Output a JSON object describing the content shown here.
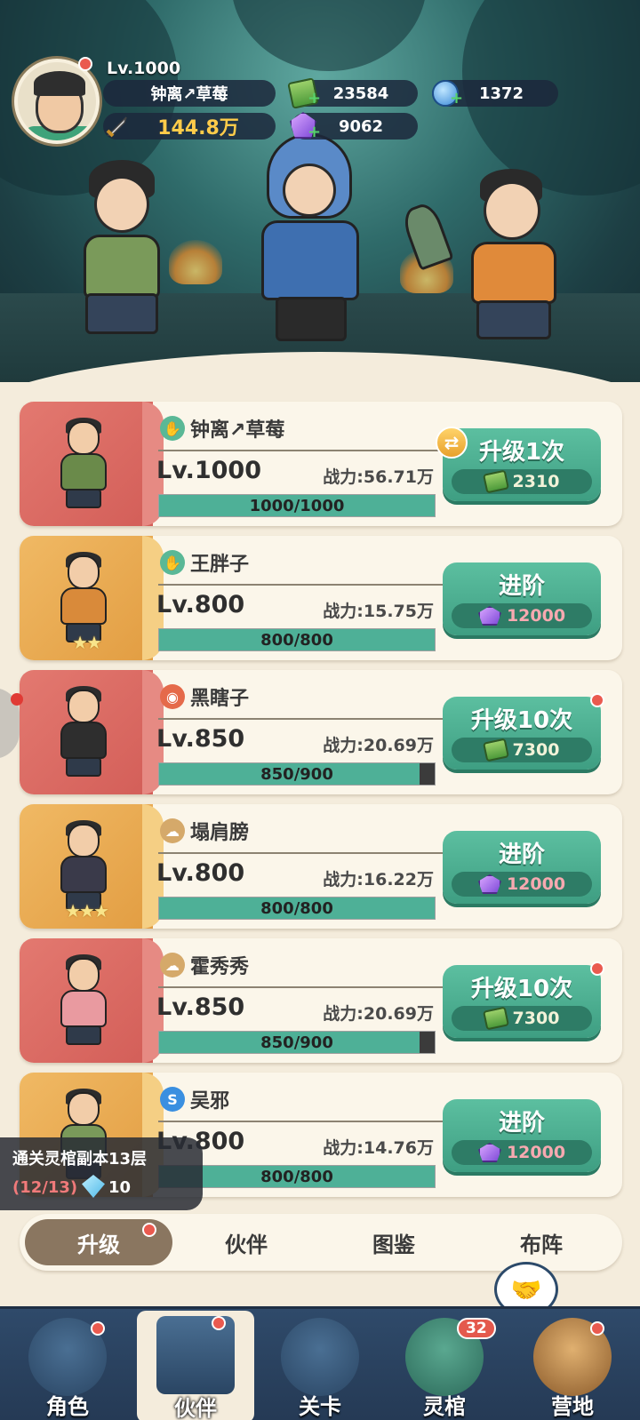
{
  "player": {
    "level": "Lv.1000",
    "name": "钟离↗草莓",
    "power": "144.8万",
    "cash": "23584",
    "orbs": "1372",
    "gems": "9062"
  },
  "heroes": [
    {
      "name": "钟离↗草莓",
      "level": "Lv.1000",
      "power": "战力:56.71万",
      "progress": "1000/1000",
      "progress_fraction": 1.0,
      "action": "升级1次",
      "cost": "2310",
      "cost_type": "cash",
      "element": "green",
      "stars": "",
      "portrait": "red",
      "dot": false,
      "swap": true
    },
    {
      "name": "王胖子",
      "level": "Lv.800",
      "power": "战力:15.75万",
      "progress": "800/800",
      "progress_fraction": 1.0,
      "action": "进阶",
      "cost": "12000",
      "cost_type": "gem",
      "element": "green",
      "stars": "★★",
      "portrait": "gold",
      "dot": false,
      "swap": false
    },
    {
      "name": "黑瞎子",
      "level": "Lv.850",
      "power": "战力:20.69万",
      "progress": "850/900",
      "progress_fraction": 0.944,
      "action": "升级10次",
      "cost": "7300",
      "cost_type": "cash",
      "element": "redish",
      "stars": "",
      "portrait": "red",
      "dot": true,
      "swap": false
    },
    {
      "name": "塌肩膀",
      "level": "Lv.800",
      "power": "战力:16.22万",
      "progress": "800/800",
      "progress_fraction": 1.0,
      "action": "进阶",
      "cost": "12000",
      "cost_type": "gem",
      "element": "tan",
      "stars": "★★★",
      "portrait": "gold",
      "dot": false,
      "swap": false
    },
    {
      "name": "霍秀秀",
      "level": "Lv.850",
      "power": "战力:20.69万",
      "progress": "850/900",
      "progress_fraction": 0.944,
      "action": "升级10次",
      "cost": "7300",
      "cost_type": "cash",
      "element": "tan",
      "stars": "",
      "portrait": "red",
      "dot": true,
      "swap": false
    },
    {
      "name": "吴邪",
      "level": "Lv.800",
      "power": "战力:14.76万",
      "progress": "800/800",
      "progress_fraction": 1.0,
      "action": "进阶",
      "cost": "12000",
      "cost_type": "gem",
      "element": "blue",
      "stars": "",
      "portrait": "gold",
      "dot": false,
      "swap": false
    }
  ],
  "quest": {
    "title": "通关灵棺副本13层",
    "progress": "(12/13)",
    "reward": "10"
  },
  "subtabs": [
    "升级",
    "伙伴",
    "图鉴",
    "布阵"
  ],
  "nav": [
    {
      "label": "角色",
      "dot": true,
      "badge": ""
    },
    {
      "label": "伙伴",
      "dot": true,
      "badge": ""
    },
    {
      "label": "关卡",
      "dot": false,
      "badge": ""
    },
    {
      "label": "灵棺",
      "dot": false,
      "badge": "32"
    },
    {
      "label": "营地",
      "dot": true,
      "badge": ""
    }
  ],
  "colors": {
    "accent_green": "#4eb097",
    "portrait_red": "#d35e58",
    "portrait_gold": "#e29d42",
    "alert_red": "#ea5a4f"
  }
}
